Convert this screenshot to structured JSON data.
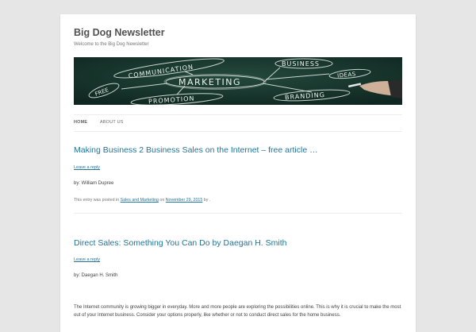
{
  "site": {
    "title": "Big Dog Newsletter",
    "description": "Welcome to the Big Dog Newsletter"
  },
  "banner": {
    "words": [
      "COMMUNICATION",
      "BUSINESS",
      "MARKETING",
      "IDEAS",
      "FREE",
      "PROMOTION",
      "BRANDING"
    ],
    "colors": {
      "board": "#17352c",
      "chalk": "#e8efe9"
    }
  },
  "nav": {
    "items": [
      {
        "label": "HOME",
        "current": true
      },
      {
        "label": "ABOUT US",
        "current": false
      }
    ]
  },
  "posts": [
    {
      "title": "Making Business 2 Business Sales on the Internet – free article …",
      "reply": "Leave a reply",
      "byline": "by: William Dupree",
      "meta": {
        "prefix": "This entry was posted in",
        "category": "Sales and Marketing",
        "on": "on",
        "date": "November 29, 2015",
        "by": "by ."
      }
    },
    {
      "title": "Direct Sales: Something You Can Do by Daegan H. Smith",
      "reply": "Leave a reply",
      "byline": "by: Daegan H. Smith",
      "excerpt": "The Internet community is growing bigger in everyday. More and more people are exploring the possibilities online. This is why it is crucial to make the most out of your Internet business. Consider your options properly, like whether or not to conduct direct sales for the home business."
    }
  ],
  "colors": {
    "link": "#21759b",
    "background": "#e6e6e6",
    "page": "#ffffff"
  }
}
